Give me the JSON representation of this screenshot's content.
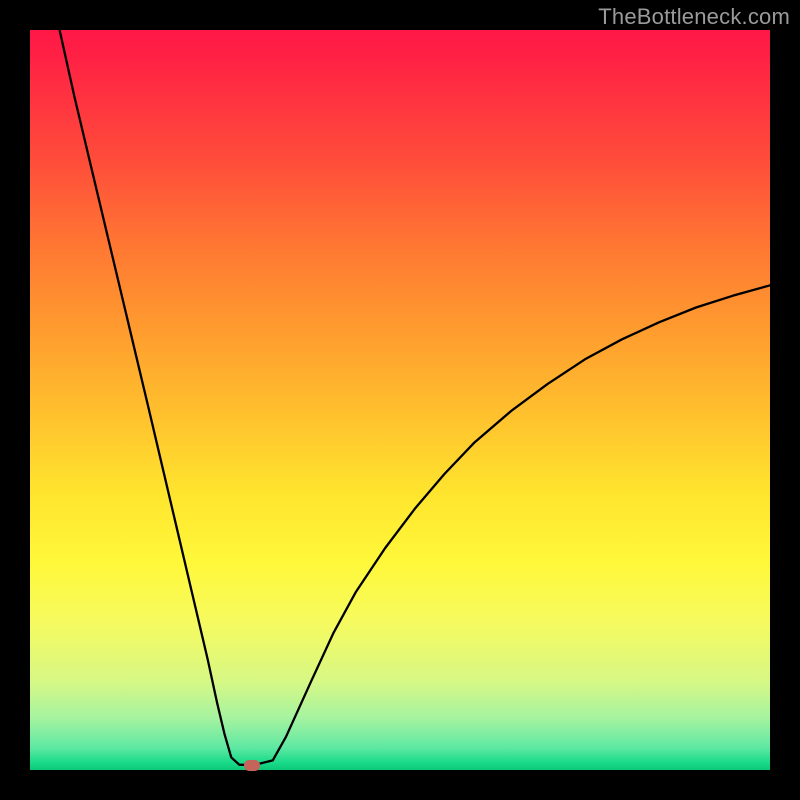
{
  "watermark": {
    "text": "TheBottleneck.com"
  },
  "chart_data": {
    "type": "line",
    "title": "",
    "xlabel": "",
    "ylabel": "",
    "xlim": [
      0,
      100
    ],
    "ylim": [
      0,
      100
    ],
    "grid": false,
    "legend": false,
    "series": [
      {
        "name": "curve",
        "x": [
          4,
          6,
          8.5,
          11,
          13.5,
          16,
          18,
          20,
          22,
          24,
          25.3,
          26.3,
          27.2,
          28.3,
          29.3,
          30.4,
          32.8,
          34.6,
          38,
          41,
          44,
          48,
          52,
          56,
          60,
          65,
          70,
          75,
          80,
          85,
          90,
          95,
          100
        ],
        "y": [
          100,
          91,
          80.5,
          70,
          59.5,
          49,
          40.5,
          32,
          23.5,
          15,
          9,
          4.8,
          1.7,
          0.7,
          0.7,
          0.7,
          1.3,
          4.5,
          12,
          18.5,
          24,
          30,
          35.3,
          40,
          44.2,
          48.5,
          52.2,
          55.5,
          58.2,
          60.5,
          62.5,
          64.1,
          65.5
        ]
      }
    ],
    "marker": {
      "x": 30,
      "y": 0.7,
      "color": "#c3655a"
    }
  }
}
